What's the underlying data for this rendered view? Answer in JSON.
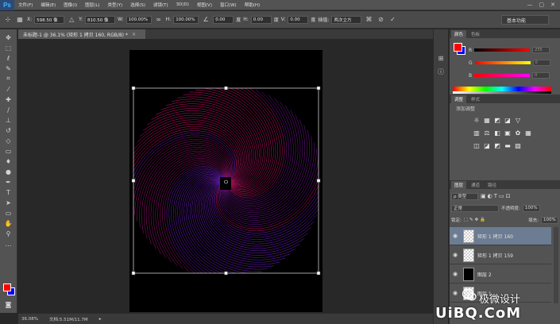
{
  "app": {
    "logo": "Ps",
    "menu": [
      "文件(F)",
      "编辑(E)",
      "图像(I)",
      "图层(L)",
      "类型(Y)",
      "选择(S)",
      "滤镜(T)",
      "3D(D)",
      "视图(V)",
      "窗口(W)",
      "帮助(H)"
    ],
    "window_controls": [
      "—",
      "▢",
      "✕"
    ]
  },
  "options": {
    "x_label": "X:",
    "x_value": "598.50 像",
    "y_label": "Y:",
    "y_value": "810.50 像",
    "w_label": "W:",
    "w_value": "100.00%",
    "h_label": "H:",
    "h_value": "100.00%",
    "angle_value": "0.00",
    "angle_unit": "度",
    "hskew_label": "H:",
    "hskew_value": "0.00",
    "hskew_unit": "度",
    "vskew_label": "V:",
    "vskew_value": "0.00",
    "vskew_unit": "度",
    "interp_label": "插值:",
    "interp_value": "两次立方",
    "cancel_icon": "cancel-icon",
    "commit_icon": "check-icon",
    "workspace": "基本功能"
  },
  "document": {
    "tab_title": "未标题-1 @ 36.1% (矩形 1 拷贝 160, RGB/8) *",
    "tab_close": "×",
    "zoom": "36.08%",
    "doc_info": "文档:5.51M/11.7M"
  },
  "color_panel": {
    "tabs": [
      "颜色",
      "色板"
    ],
    "fg_color": "#ff0000",
    "bg_color": "#0000ff",
    "channels": [
      {
        "label": "R",
        "value": "255",
        "gradient": "linear-gradient(to right, #000, #ff0000)"
      },
      {
        "label": "G",
        "value": "0",
        "gradient": "linear-gradient(to right, #ff0000, #ffff00)"
      },
      {
        "label": "B",
        "value": "0",
        "gradient": "linear-gradient(to right, #ff0000, #ff00ff)"
      }
    ]
  },
  "adjust_panel": {
    "tabs": [
      "调整",
      "样式"
    ],
    "title": "添加调整",
    "row1": [
      "☼",
      "▦",
      "◩",
      "◪",
      "▽"
    ],
    "row2": [
      "▥",
      "⚖",
      "◧",
      "▣",
      "✿",
      "▦"
    ],
    "row3": [
      "◫",
      "◪",
      "◩",
      "▬",
      "▨"
    ]
  },
  "layers_panel": {
    "tabs": [
      "图层",
      "通道",
      "路径"
    ],
    "filter_kind": "ρ 类型",
    "blend_mode": "正常",
    "opacity_label": "不透明度:",
    "opacity_value": "100%",
    "lock_label": "锁定:",
    "fill_label": "填充:",
    "fill_value": "100%",
    "layers": [
      {
        "name": "矩形 1 拷贝 160",
        "thumb": "check",
        "selected": true
      },
      {
        "name": "矩形 1 拷贝 159",
        "thumb": "check",
        "selected": false
      },
      {
        "name": "图层 2",
        "thumb": "black",
        "selected": false
      },
      {
        "name": "图层 1",
        "thumb": "check",
        "selected": false
      }
    ]
  },
  "watermark": {
    "line1": "极微设计",
    "line2": "UiBQ.CoM"
  }
}
